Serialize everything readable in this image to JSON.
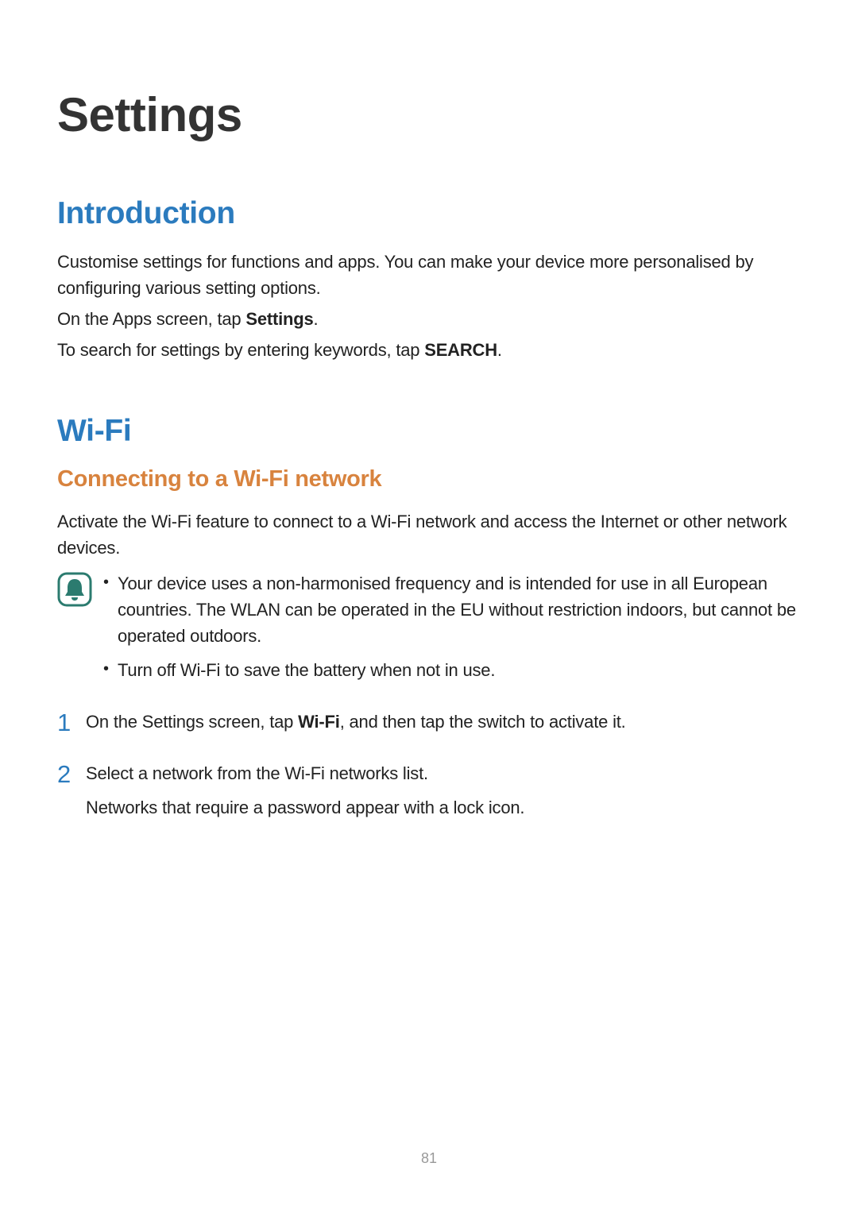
{
  "chapter_title": "Settings",
  "introduction": {
    "heading": "Introduction",
    "para1": "Customise settings for functions and apps. You can make your device more personalised by configuring various setting options.",
    "para2_pre": "On the Apps screen, tap ",
    "para2_bold": "Settings",
    "para2_post": ".",
    "para3_pre": "To search for settings by entering keywords, tap ",
    "para3_bold": "SEARCH",
    "para3_post": "."
  },
  "wifi": {
    "heading": "Wi-Fi",
    "subheading": "Connecting to a Wi-Fi network",
    "para1": "Activate the Wi-Fi feature to connect to a Wi-Fi network and access the Internet or other network devices.",
    "notes": [
      "Your device uses a non-harmonised frequency and is intended for use in all European countries. The WLAN can be operated in the EU without restriction indoors, but cannot be operated outdoors.",
      "Turn off Wi-Fi to save the battery when not in use."
    ],
    "steps": [
      {
        "num": "1",
        "line1_pre": "On the Settings screen, tap ",
        "line1_bold": "Wi-Fi",
        "line1_post": ", and then tap the switch to activate it."
      },
      {
        "num": "2",
        "line1": "Select a network from the Wi-Fi networks list.",
        "line2": "Networks that require a password appear with a lock icon."
      }
    ]
  },
  "page_number": "81",
  "bullet_char": "•"
}
